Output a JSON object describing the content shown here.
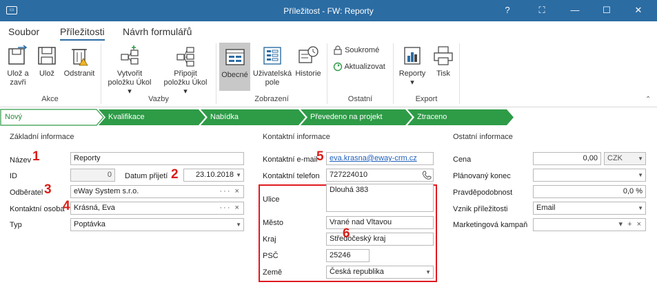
{
  "window": {
    "title": "Příležitost - FW: Reporty",
    "app_icon": "window-app-icon",
    "controls": [
      "help-icon",
      "restore-screen-icon",
      "minimize-icon",
      "maximize-icon",
      "close-icon"
    ]
  },
  "menu": {
    "tabs": [
      "Soubor",
      "Příležitosti",
      "Návrh formulářů"
    ],
    "active_tab": "Příležitosti"
  },
  "ribbon": {
    "groups": {
      "akce": "Akce",
      "vazby": "Vazby",
      "zobrazeni": "Zobrazení",
      "ostatni": "Ostatní",
      "export": "Export"
    },
    "buttons": {
      "uloz_zavri": [
        "Ulož a",
        "zavři"
      ],
      "uloz": "Ulož",
      "odstranit": "Odstranit",
      "vytvorit_ukol": [
        "Vytvořit",
        "položku Úkol"
      ],
      "pripojit_ukol": [
        "Připojit",
        "položku Úkol"
      ],
      "obecne": "Obecné",
      "uzivatelska_pole": [
        "Uživatelská",
        "pole"
      ],
      "historie": "Historie",
      "soukrome": "Soukromé",
      "aktualizovat": "Aktualizovat",
      "reporty": "Reporty",
      "tisk": "Tisk"
    },
    "dropdown_caret": "▾",
    "collapse_caret": "⌃"
  },
  "pipeline": {
    "stages": [
      "Nový",
      "Kvalifikace",
      "Nabídka",
      "Převedeno na projekt",
      "Ztraceno"
    ],
    "active_stage": "Nový",
    "colors": {
      "active_bg": "#ffffff",
      "active_text": "#2e8b3e",
      "stage_bg": "#2e9b47"
    }
  },
  "basic_info": {
    "heading": "Základní informace",
    "nazev_label": "Název",
    "nazev_value": "Reporty",
    "id_label": "ID",
    "id_value": "0",
    "datum_label": "Datum přijetí",
    "datum_value": "23.10.2018",
    "odberatel_label": "Odběratel",
    "odberatel_value": "eWay System s.r.o.",
    "kontaktni_osoba_label": "Kontaktní osoba",
    "kontaktni_osoba_value": "Krásná, Eva",
    "typ_label": "Typ",
    "typ_value": "Poptávka"
  },
  "contact_info": {
    "heading": "Kontaktní informace",
    "email_label": "Kontaktní e-mail",
    "email_value": "eva.krasna@eway-crm.cz",
    "phone_label": "Kontaktní telefon",
    "phone_value": "727224010",
    "ulice_label": "Ulice",
    "ulice_value": "Dlouhá 383",
    "mesto_label": "Město",
    "mesto_value": "Vrané nad Vltavou",
    "kraj_label": "Kraj",
    "kraj_value": "Středočeský kraj",
    "psc_label": "PSČ",
    "psc_value": "25246",
    "zeme_label": "Země",
    "zeme_value": "Česká republika"
  },
  "other_info": {
    "heading": "Ostatní informace",
    "cena_label": "Cena",
    "cena_value": "0,00",
    "mena_value": "CZK",
    "planovany_konec_label": "Plánovaný konec",
    "planovany_konec_value": "",
    "pravdepodobnost_label": "Pravděpodobnost",
    "pravdepodobnost_value": "0,0 %",
    "vznik_label": "Vznik příležitosti",
    "vznik_value": "Email",
    "kampan_label": "Marketingová kampaň",
    "kampan_value": ""
  },
  "annotations": {
    "markers": [
      "1",
      "2",
      "3",
      "4",
      "5",
      "6"
    ],
    "marker_color": "#d91e18"
  },
  "field_tools": {
    "lookup": "··· ×",
    "lookup_add": "▾ + ×"
  },
  "colors": {
    "titlebar": "#2b6ca3",
    "accent": "#2b6ca3",
    "pipeline_green": "#2e9b47",
    "highlight_red": "#e0191f",
    "link": "#1f5fbf"
  }
}
